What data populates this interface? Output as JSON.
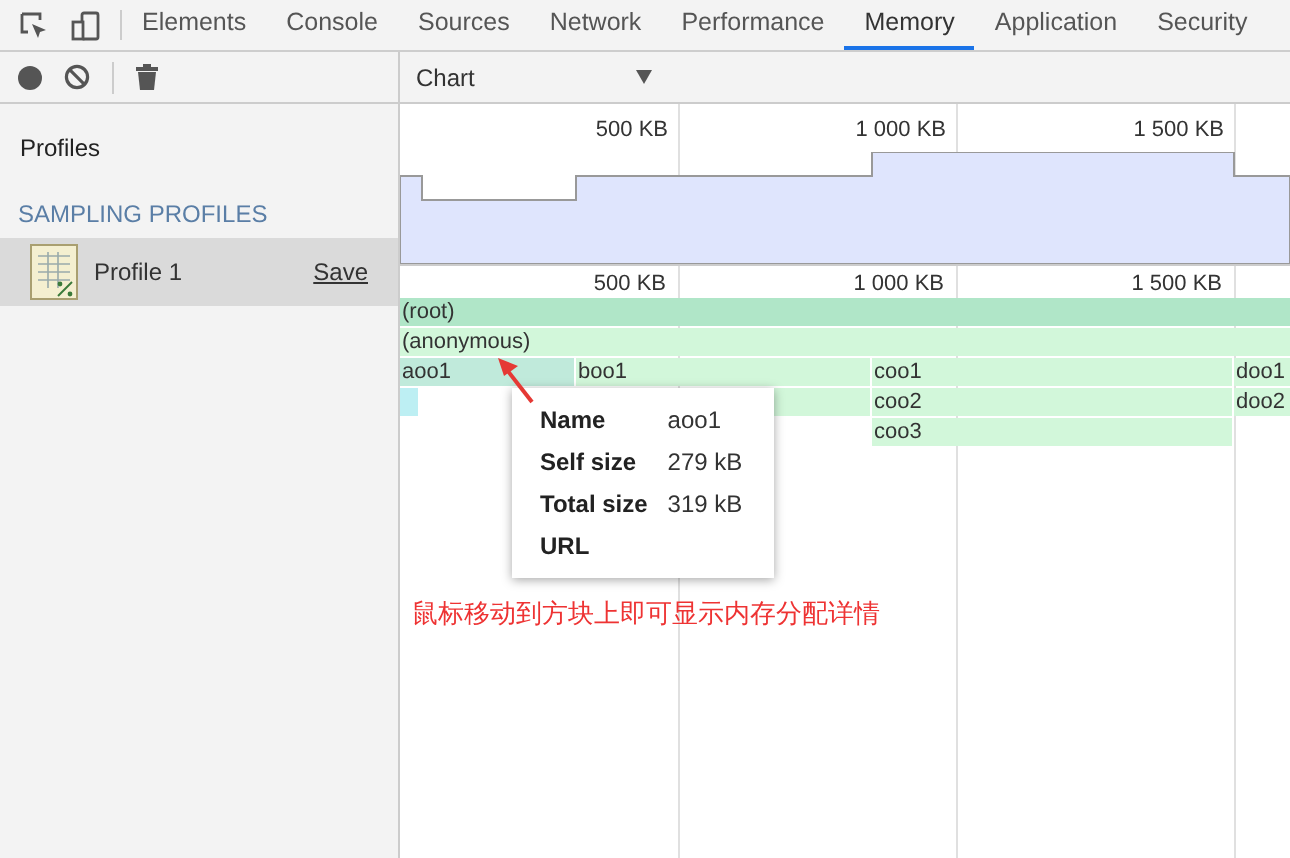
{
  "tabs": [
    {
      "label": "Elements",
      "selected": false
    },
    {
      "label": "Console",
      "selected": false
    },
    {
      "label": "Sources",
      "selected": false
    },
    {
      "label": "Network",
      "selected": false
    },
    {
      "label": "Performance",
      "selected": false
    },
    {
      "label": "Memory",
      "selected": true
    },
    {
      "label": "Application",
      "selected": false
    },
    {
      "label": "Security",
      "selected": false
    }
  ],
  "view_select": {
    "value": "Chart"
  },
  "sidebar": {
    "title": "Profiles",
    "section": "SAMPLING PROFILES",
    "items": [
      {
        "label": "Profile 1",
        "action": "Save",
        "selected": true
      }
    ]
  },
  "overview_ticks": [
    "500 KB",
    "1 000 KB",
    "1 500 KB"
  ],
  "axis_ticks": [
    "500 KB",
    "1 000 KB",
    "1 500 KB"
  ],
  "flame_rows": [
    {
      "bars": [
        {
          "label": "(root)",
          "color": "#b0e6c8",
          "selected": false
        }
      ]
    },
    {
      "bars": [
        {
          "label": "(anonymous)",
          "color": "#d2f7da",
          "selected": false
        }
      ]
    },
    {
      "bars": [
        {
          "label": "aoo1",
          "color": "#c0eadb",
          "selected": false
        },
        {
          "label": "boo1",
          "color": "#d2f7da",
          "selected": false
        },
        {
          "label": "coo1",
          "color": "#d2f7da",
          "selected": false
        },
        {
          "label": "doo1",
          "color": "#d2f7da",
          "selected": false
        }
      ]
    },
    {
      "bars": [
        {
          "color": "#bdeff3",
          "selected": false
        },
        {
          "color": "#d2f7da",
          "selected": false
        },
        {
          "label": "coo2",
          "color": "#d2f7da",
          "selected": false
        },
        {
          "label": "doo2",
          "color": "#d2f7da",
          "selected": false
        }
      ]
    },
    {
      "bars": [
        {
          "label": "coo3",
          "color": "#d2f7da",
          "selected": false
        }
      ]
    }
  ],
  "tooltip": {
    "rows": [
      {
        "key": "Name",
        "value": "aoo1"
      },
      {
        "key": "Self size",
        "value": "279 kB"
      },
      {
        "key": "Total size",
        "value": "319 kB"
      },
      {
        "key": "URL"
      }
    ]
  },
  "annotation": "鼠标移动到方块上即可显示内存分配详情"
}
